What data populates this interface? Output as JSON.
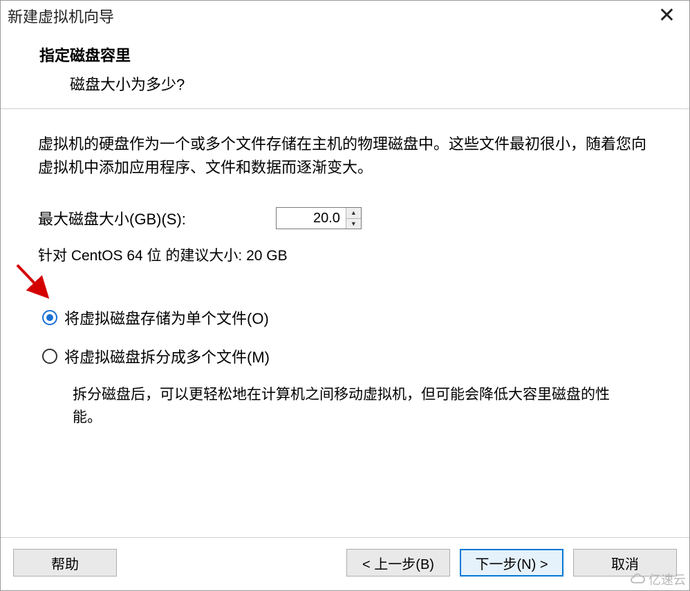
{
  "window": {
    "title": "新建虚拟机向导",
    "close": "✕"
  },
  "header": {
    "title": "指定磁盘容里",
    "subtitle": "磁盘大小为多少?"
  },
  "content": {
    "info": "虚拟机的硬盘作为一个或多个文件存储在主机的物理磁盘中。这些文件最初很小，随着您向虚拟机中添加应用程序、文件和数据而逐渐变大。",
    "size_label": "最大磁盘大小(GB)(S):",
    "size_value": "20.0",
    "recommend": "针对 CentOS 64 位 的建议大小: 20 GB",
    "radio": {
      "single": "将虚拟磁盘存储为单个文件(O)",
      "split": "将虚拟磁盘拆分成多个文件(M)",
      "split_desc": "拆分磁盘后，可以更轻松地在计算机之间移动虚拟机，但可能会降低大容里磁盘的性能。",
      "selected": "single"
    }
  },
  "footer": {
    "help": "帮助",
    "back": "< 上一步(B)",
    "next": "下一步(N) >",
    "cancel": "取消"
  },
  "watermark": {
    "text": "亿速云"
  }
}
